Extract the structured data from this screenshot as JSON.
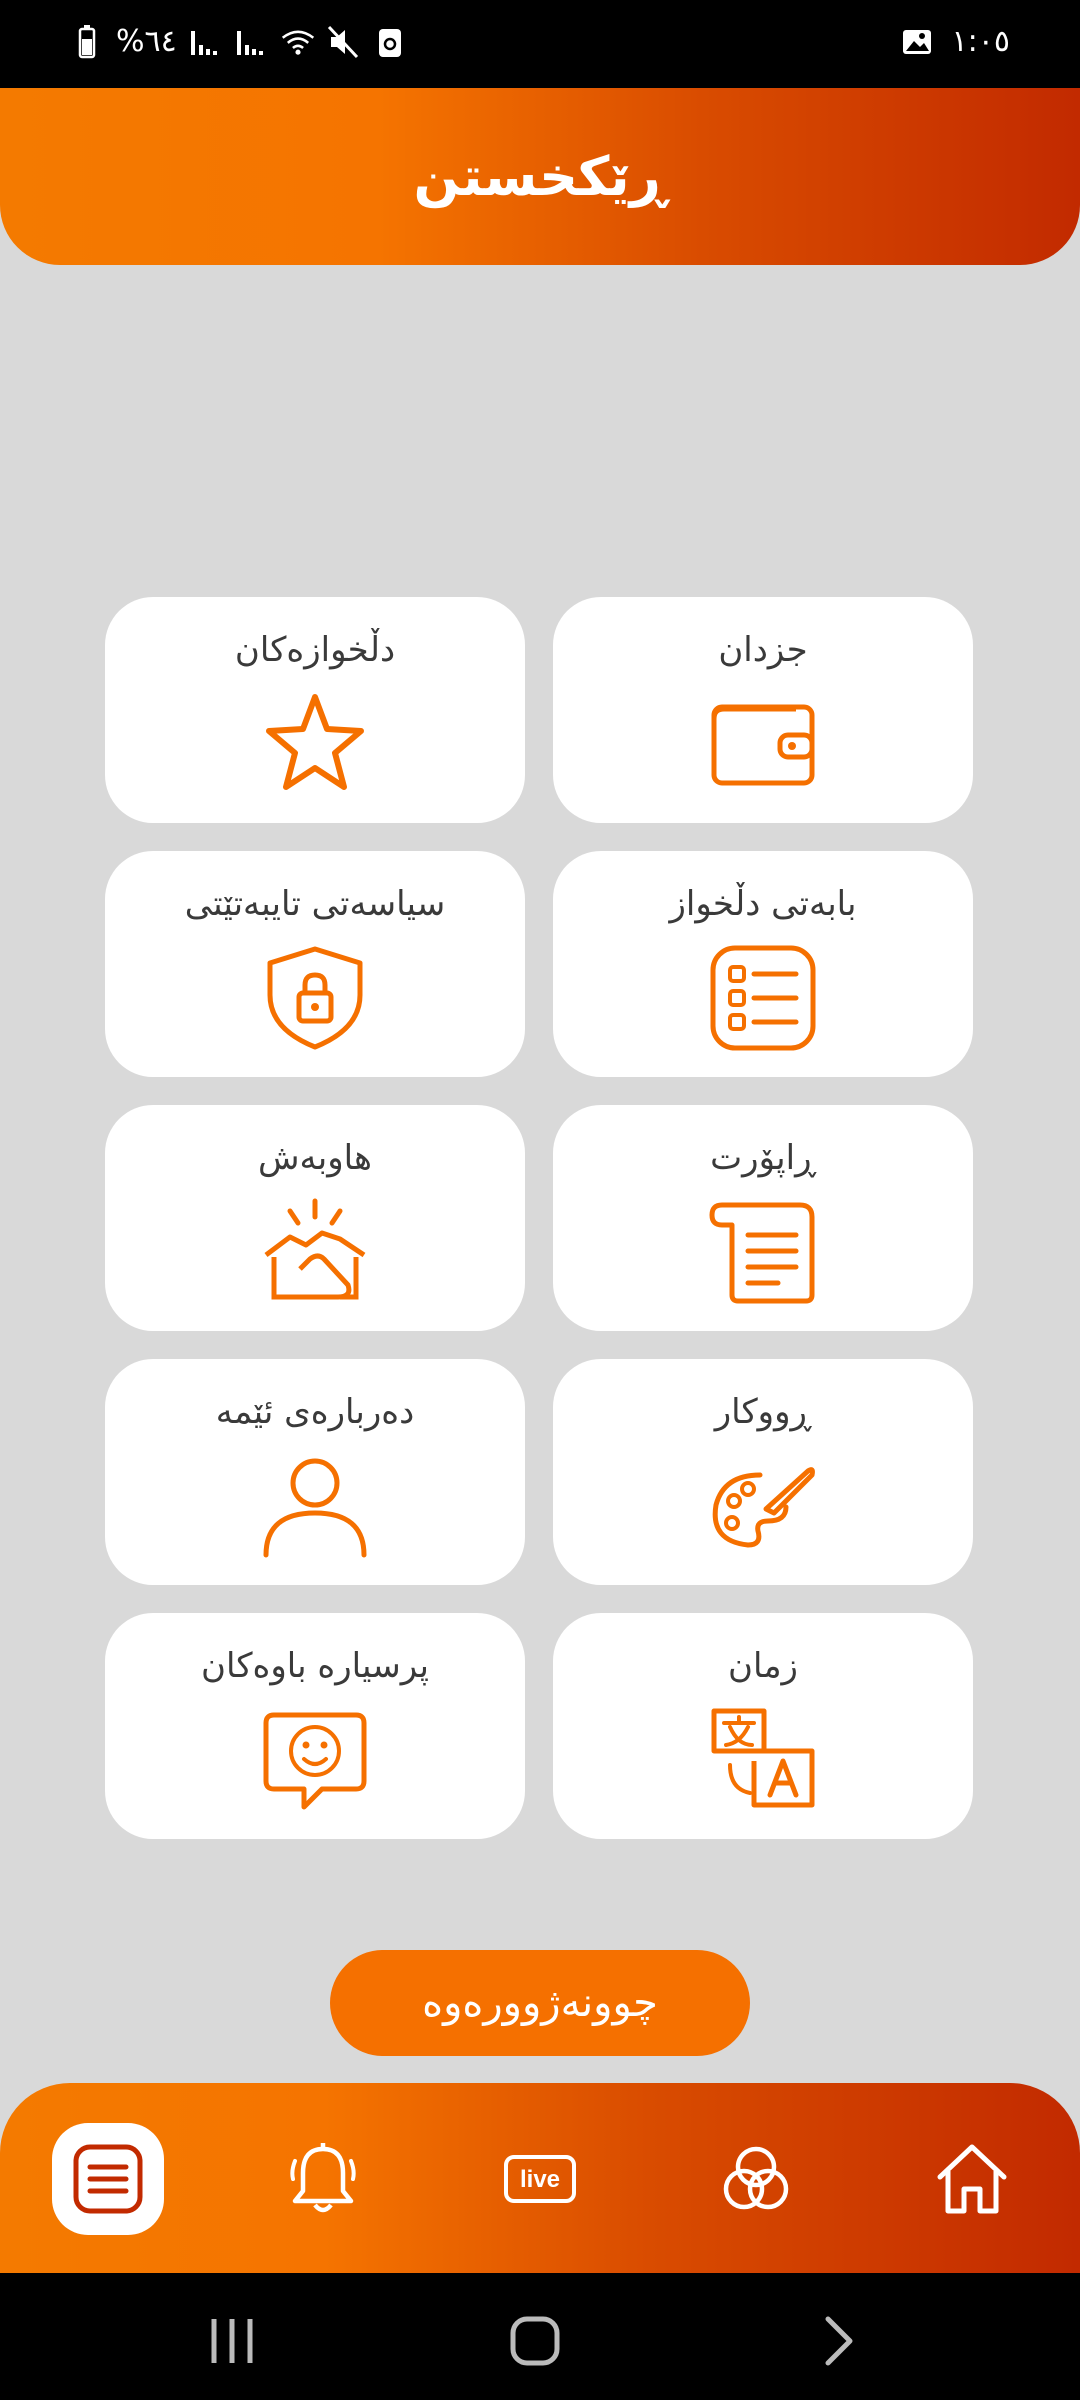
{
  "status_bar": {
    "battery": "%٦٤",
    "time": "١:٠٥"
  },
  "header": {
    "title": "ڕێکخستن"
  },
  "grid": {
    "items": [
      {
        "label": "دڵخوازەکان",
        "icon": "star-icon"
      },
      {
        "label": "جزدان",
        "icon": "wallet-icon"
      },
      {
        "label": "سیاسەتی تایبەتێتی",
        "icon": "shield-lock-icon"
      },
      {
        "label": "بابەتی دڵخواز",
        "icon": "list-icon"
      },
      {
        "label": "هاوبەش",
        "icon": "handshake-icon"
      },
      {
        "label": "ڕاپۆرت",
        "icon": "scroll-document-icon"
      },
      {
        "label": "دەربارەی ئێمە",
        "icon": "person-icon"
      },
      {
        "label": "ڕووکار",
        "icon": "palette-icon"
      },
      {
        "label": "پرسیارە باوەکان",
        "icon": "chat-smile-icon"
      },
      {
        "label": "زمان",
        "icon": "translate-icon"
      }
    ]
  },
  "back_button": {
    "label": "چوونەژوورەوە"
  },
  "bottom_nav": {
    "items": [
      {
        "name": "settings",
        "icon": "menu-list-icon",
        "active": true
      },
      {
        "name": "notifications",
        "icon": "bell-icon"
      },
      {
        "name": "live",
        "icon": "live-icon",
        "label": "live"
      },
      {
        "name": "categories",
        "icon": "circles-icon"
      },
      {
        "name": "home",
        "icon": "home-icon"
      }
    ]
  },
  "colors": {
    "accent": "#f57000",
    "accent_dark": "#c22a00",
    "background": "#d9d9d9"
  }
}
